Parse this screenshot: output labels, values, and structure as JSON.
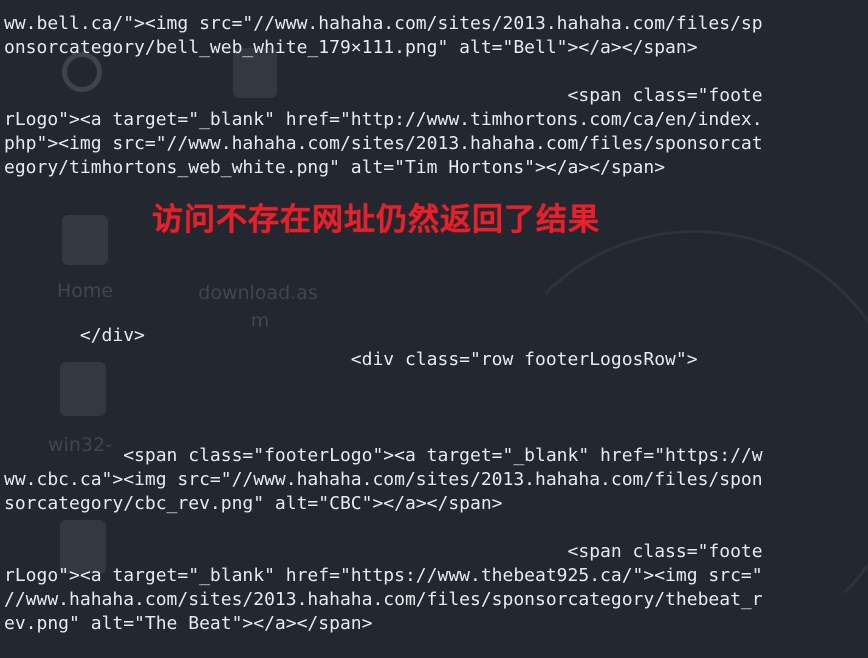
{
  "desktop_icons": [
    {
      "label": "Home"
    },
    {
      "label": "download.as"
    },
    {
      "label": "m"
    },
    {
      "label": "win32-"
    }
  ],
  "terminal": {
    "lines": [
      "ww.bell.ca/\"><img src=\"//www.hahaha.com/sites/2013.hahaha.com/files/sp",
      "onsorcategory/bell_web_white_179×111.png\" alt=\"Bell\"></a></span>",
      "",
      "                                                    <span class=\"foote",
      "rLogo\"><a target=\"_blank\" href=\"http://www.timhortons.com/ca/en/index.",
      "php\"><img src=\"//www.hahaha.com/sites/2013.hahaha.com/files/sponsorcat",
      "egory/timhortons_web_white.png\" alt=\"Tim Hortons\"></a></span>",
      "",
      "",
      "",
      "",
      "",
      "",
      "       </div>",
      "                                <div class=\"row footerLogosRow\">",
      "",
      "",
      "",
      "           <span class=\"footerLogo\"><a target=\"_blank\" href=\"https://w",
      "ww.cbc.ca\"><img src=\"//www.hahaha.com/sites/2013.hahaha.com/files/spon",
      "sorcategory/cbc_rev.png\" alt=\"CBC\"></a></span>",
      "",
      "                                                    <span class=\"foote",
      "rLogo\"><a target=\"_blank\" href=\"https://www.thebeat925.ca/\"><img src=\"",
      "//www.hahaha.com/sites/2013.hahaha.com/files/sponsorcategory/thebeat_r",
      "ev.png\" alt=\"The Beat\"></a></span>"
    ]
  },
  "annotation": {
    "text": "访问不存在网址仍然返回了结果",
    "color": "#e8202a"
  }
}
